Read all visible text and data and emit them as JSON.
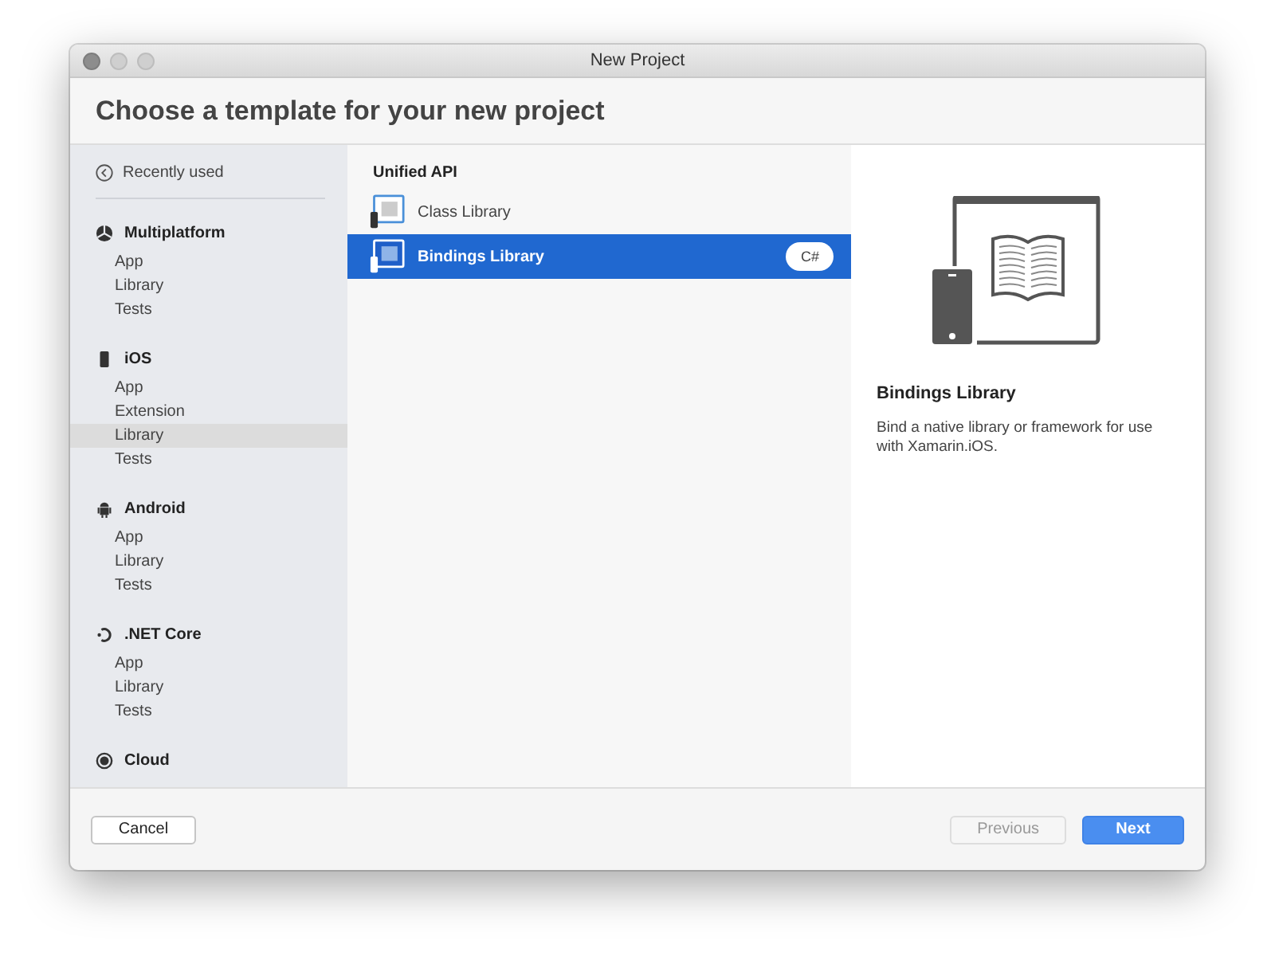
{
  "window": {
    "title": "New Project"
  },
  "header": {
    "title": "Choose a template for your new project"
  },
  "sidebar": {
    "recent": "Recently used",
    "groups": [
      {
        "kind": "multiplatform",
        "label": "Multiplatform",
        "items": [
          {
            "label": "App",
            "selected": false
          },
          {
            "label": "Library",
            "selected": false
          },
          {
            "label": "Tests",
            "selected": false
          }
        ]
      },
      {
        "kind": "ios",
        "label": "iOS",
        "items": [
          {
            "label": "App",
            "selected": false
          },
          {
            "label": "Extension",
            "selected": false
          },
          {
            "label": "Library",
            "selected": true
          },
          {
            "label": "Tests",
            "selected": false
          }
        ]
      },
      {
        "kind": "android",
        "label": "Android",
        "items": [
          {
            "label": "App",
            "selected": false
          },
          {
            "label": "Library",
            "selected": false
          },
          {
            "label": "Tests",
            "selected": false
          }
        ]
      },
      {
        "kind": "netcore",
        "label": ".NET Core",
        "items": [
          {
            "label": "App",
            "selected": false
          },
          {
            "label": "Library",
            "selected": false
          },
          {
            "label": "Tests",
            "selected": false
          }
        ]
      },
      {
        "kind": "cloud",
        "label": "Cloud"
      }
    ]
  },
  "templates": {
    "section": "Unified API",
    "items": [
      {
        "label": "Class Library",
        "selected": false
      },
      {
        "label": "Bindings Library",
        "selected": true,
        "badge": "C#"
      }
    ]
  },
  "details": {
    "title": "Bindings Library",
    "description": "Bind a native library or framework for use with Xamarin.iOS."
  },
  "buttons": [
    {
      "label": "Cancel",
      "kind": "secondary",
      "disabled": false
    },
    {
      "label": "Previous",
      "kind": "secondary",
      "disabled": true
    },
    {
      "label": "Next",
      "kind": "primary",
      "disabled": false
    }
  ]
}
